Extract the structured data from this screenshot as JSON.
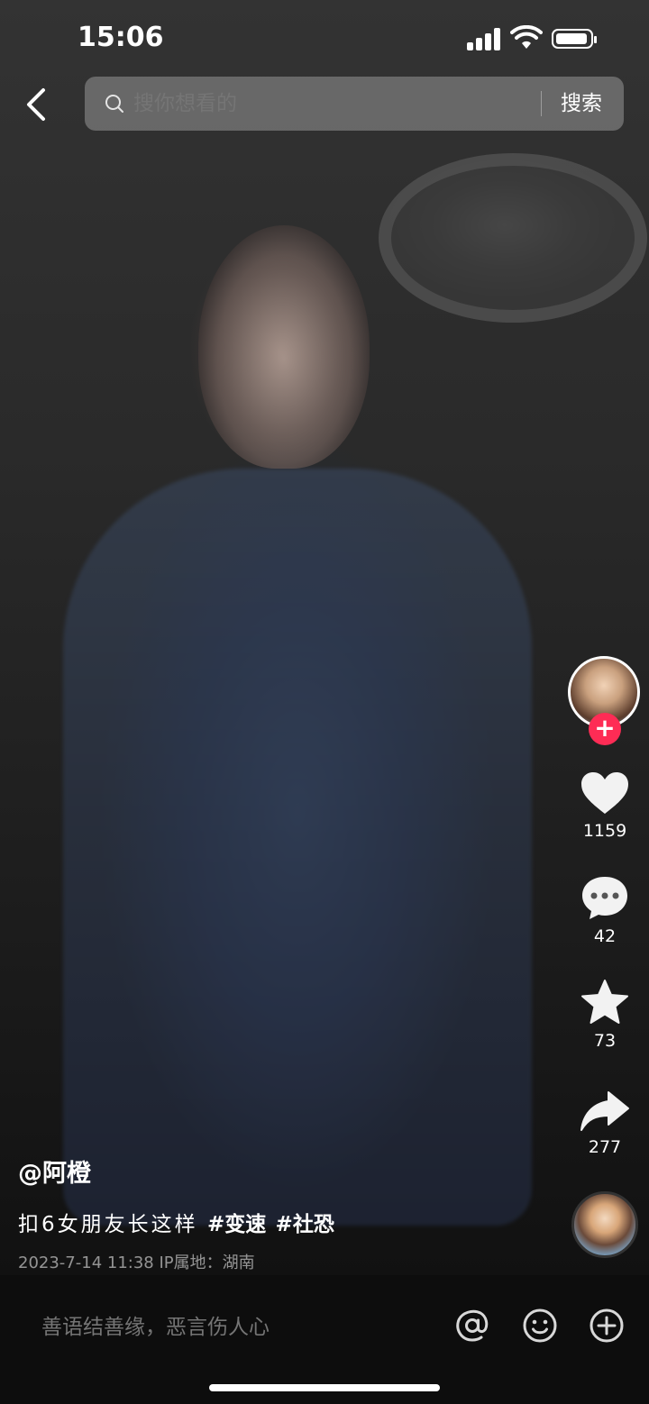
{
  "status_bar": {
    "time": "15:06"
  },
  "search": {
    "placeholder": "搜你想看的",
    "button_label": "搜索"
  },
  "actions": {
    "like_count": "1159",
    "comment_count": "42",
    "favorite_count": "73",
    "share_count": "277"
  },
  "follow_symbol": "+",
  "post": {
    "author": "@阿橙",
    "description": "扣6女朋友长这样",
    "hashtags": [
      "#变速",
      "#社恐"
    ],
    "date": "2023-7-14 11:38",
    "ip_location": "IP属地：湖南"
  },
  "comment_bar": {
    "placeholder": "善语结善缘，恶言伤人心"
  },
  "colors": {
    "accent": "#fe2c55",
    "background": "#000000",
    "bottom_bar": "#0d0d0d"
  },
  "icons": [
    "back-icon",
    "search-icon",
    "heart-icon",
    "comment-icon",
    "star-icon",
    "share-icon",
    "at-icon",
    "emoji-icon",
    "plus-icon"
  ]
}
